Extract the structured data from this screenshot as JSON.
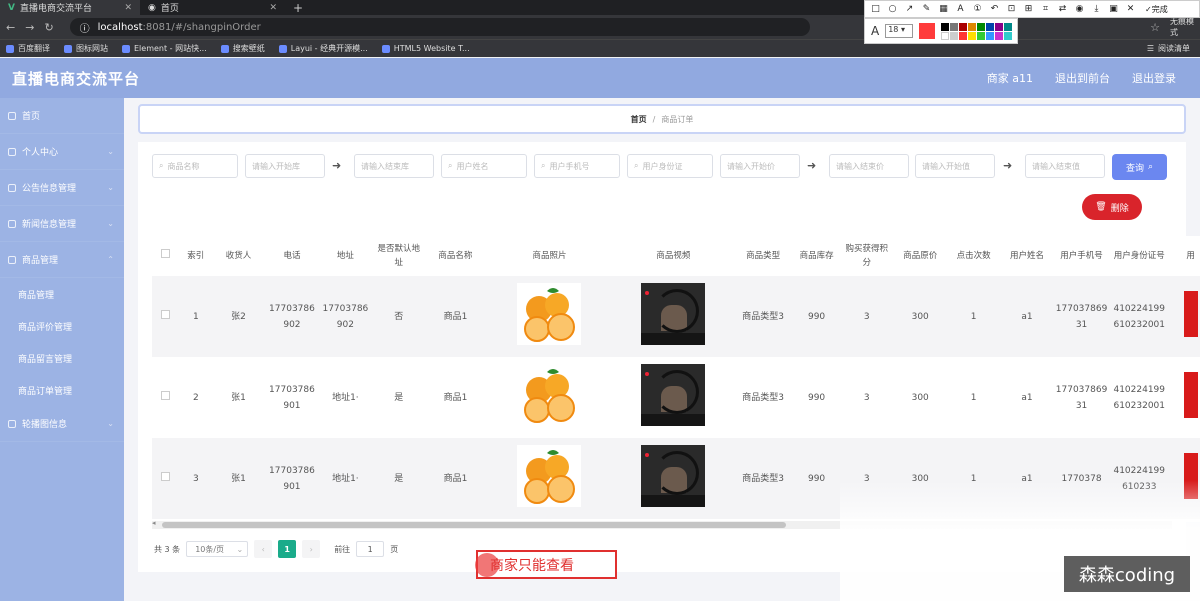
{
  "browser": {
    "tabs": [
      {
        "title": "直播电商交流平台",
        "active": true
      },
      {
        "title": "首页",
        "active": false
      }
    ],
    "url_host": "localhost",
    "url_path": ":8081/#/shangpinOrder",
    "bookmarks": [
      "百度翻译",
      "图标网站",
      "Element - 网站快...",
      "搜索壁纸",
      "Layui - 经典开源模...",
      "HTML5 Website T..."
    ],
    "reading_list": "阅读清单",
    "profile": "无痕模式"
  },
  "snap": {
    "done_label": "完成",
    "font_size": "18",
    "current_color": "#ff3b3b",
    "text_tool": "A"
  },
  "app": {
    "title": "直播电商交流平台",
    "header_links": [
      "商家 a11",
      "退出到前台",
      "退出登录"
    ]
  },
  "sidebar": {
    "items": [
      {
        "label": "首页",
        "icon": "home-icon"
      },
      {
        "label": "个人中心",
        "icon": "user-icon"
      },
      {
        "label": "公告信息管理",
        "icon": "bell-icon"
      },
      {
        "label": "新闻信息管理",
        "icon": "news-icon"
      },
      {
        "label": "商品管理",
        "icon": "goods-icon"
      }
    ],
    "sub_items": [
      "商品管理",
      "商品评价管理",
      "商品留言管理",
      "商品订单管理"
    ],
    "after": {
      "label": "轮播图信息",
      "icon": "image-icon"
    }
  },
  "breadcrumb": {
    "home": "首页",
    "sep": "/",
    "current": "商品订单"
  },
  "search": {
    "placeholders": [
      "商品名称",
      "请输入开始库",
      "请输入结束库",
      "用户姓名",
      "用户手机号",
      "用户身份证",
      "请输入开始价",
      "请输入结束价",
      "请输入开始值",
      "请输入结束值"
    ],
    "query_label": "查询"
  },
  "actions": {
    "delete_label": "删除"
  },
  "table": {
    "headers": [
      "索引",
      "收货人",
      "电话",
      "地址",
      "是否默认地址",
      "商品名称",
      "商品照片",
      "商品视频",
      "商品类型",
      "商品库存",
      "购买获得积分",
      "商品原价",
      "点击次数",
      "用户姓名",
      "用户手机号",
      "用户身份证号",
      "用"
    ],
    "rows": [
      {
        "index": "1",
        "receiver": "张2",
        "phone": "17703786902",
        "address": "17703786902",
        "default": "否",
        "name": "商品1",
        "type": "商品类型3",
        "stock": "990",
        "points": "3",
        "price": "300",
        "clicks": "1",
        "user": "a1",
        "user_phone": "17703786931",
        "id_card": "410224199610232001"
      },
      {
        "index": "2",
        "receiver": "张1",
        "phone": "17703786901",
        "address": "地址1·",
        "default": "是",
        "name": "商品1",
        "type": "商品类型3",
        "stock": "990",
        "points": "3",
        "price": "300",
        "clicks": "1",
        "user": "a1",
        "user_phone": "17703786931",
        "id_card": "410224199610232001"
      },
      {
        "index": "3",
        "receiver": "张1",
        "phone": "17703786901",
        "address": "地址1·",
        "default": "是",
        "name": "商品1",
        "type": "商品类型3",
        "stock": "990",
        "points": "3",
        "price": "300",
        "clicks": "1",
        "user": "a1",
        "user_phone": "1770378",
        "id_card": "410224199610233"
      }
    ]
  },
  "pager": {
    "total": "共 3 条",
    "page_size": "10条/页",
    "current": "1",
    "goto_label": "前往",
    "goto_value": "1",
    "page_unit": "页",
    "prev": "‹",
    "next": "›"
  },
  "annotation": {
    "text": "商家只能查看"
  },
  "watermark": "森森coding",
  "colors": {
    "header": "#91a9e0",
    "sidebar": "#9cb3e4",
    "query": "#6b87f0",
    "delete": "#d9242b",
    "page_active": "#1aab8a"
  }
}
